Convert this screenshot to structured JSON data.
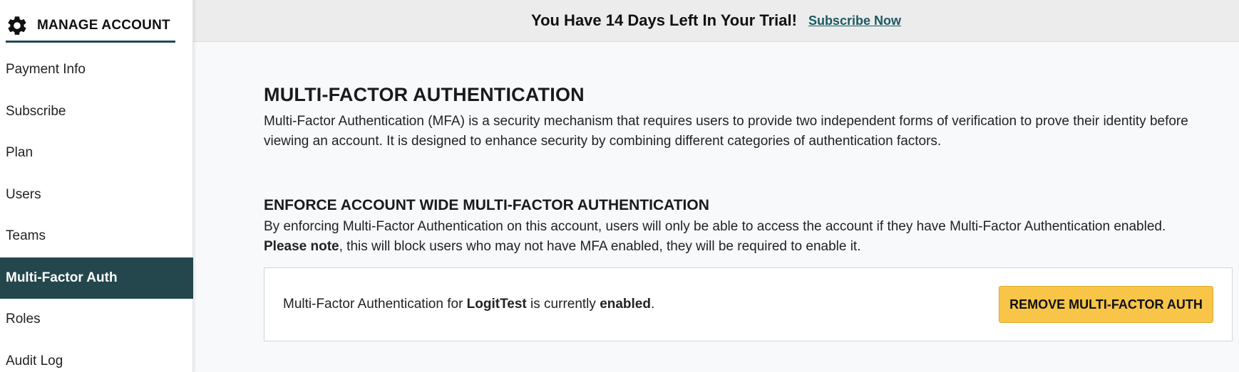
{
  "sidebar": {
    "title": "MANAGE ACCOUNT",
    "items": [
      {
        "label": "Payment Info"
      },
      {
        "label": "Subscribe"
      },
      {
        "label": "Plan"
      },
      {
        "label": "Users"
      },
      {
        "label": "Teams"
      },
      {
        "label": "Multi-Factor Auth",
        "active": true
      },
      {
        "label": "Roles"
      },
      {
        "label": "Audit Log"
      }
    ]
  },
  "banner": {
    "text": "You Have 14 Days Left In Your Trial!",
    "link": "Subscribe Now"
  },
  "main": {
    "title": "MULTI-FACTOR AUTHENTICATION",
    "description": "Multi-Factor Authentication (MFA) is a security mechanism that requires users to provide two independent forms of verification to prove their identity before viewing an account. It is designed to enhance security by combining different categories of authentication factors.",
    "enforce_title": "ENFORCE ACCOUNT WIDE MULTI-FACTOR AUTHENTICATION",
    "enforce_text": "By enforcing Multi-Factor Authentication on this account, users will only be able to access the account if they have Multi-Factor Authentication enabled.",
    "note_bold": "Please note",
    "note_text": ", this will block users who may not have MFA enabled, they will be required to enable it.",
    "status": {
      "prefix": "Multi-Factor Authentication for ",
      "account": "LogitTest",
      "middle": " is currently ",
      "state": "enabled",
      "suffix": "."
    },
    "remove_button": "REMOVE MULTI-FACTOR AUTH"
  },
  "colors": {
    "sidebar_active": "#23474d",
    "accent_button": "#f8c548",
    "link": "#1a5a61"
  }
}
